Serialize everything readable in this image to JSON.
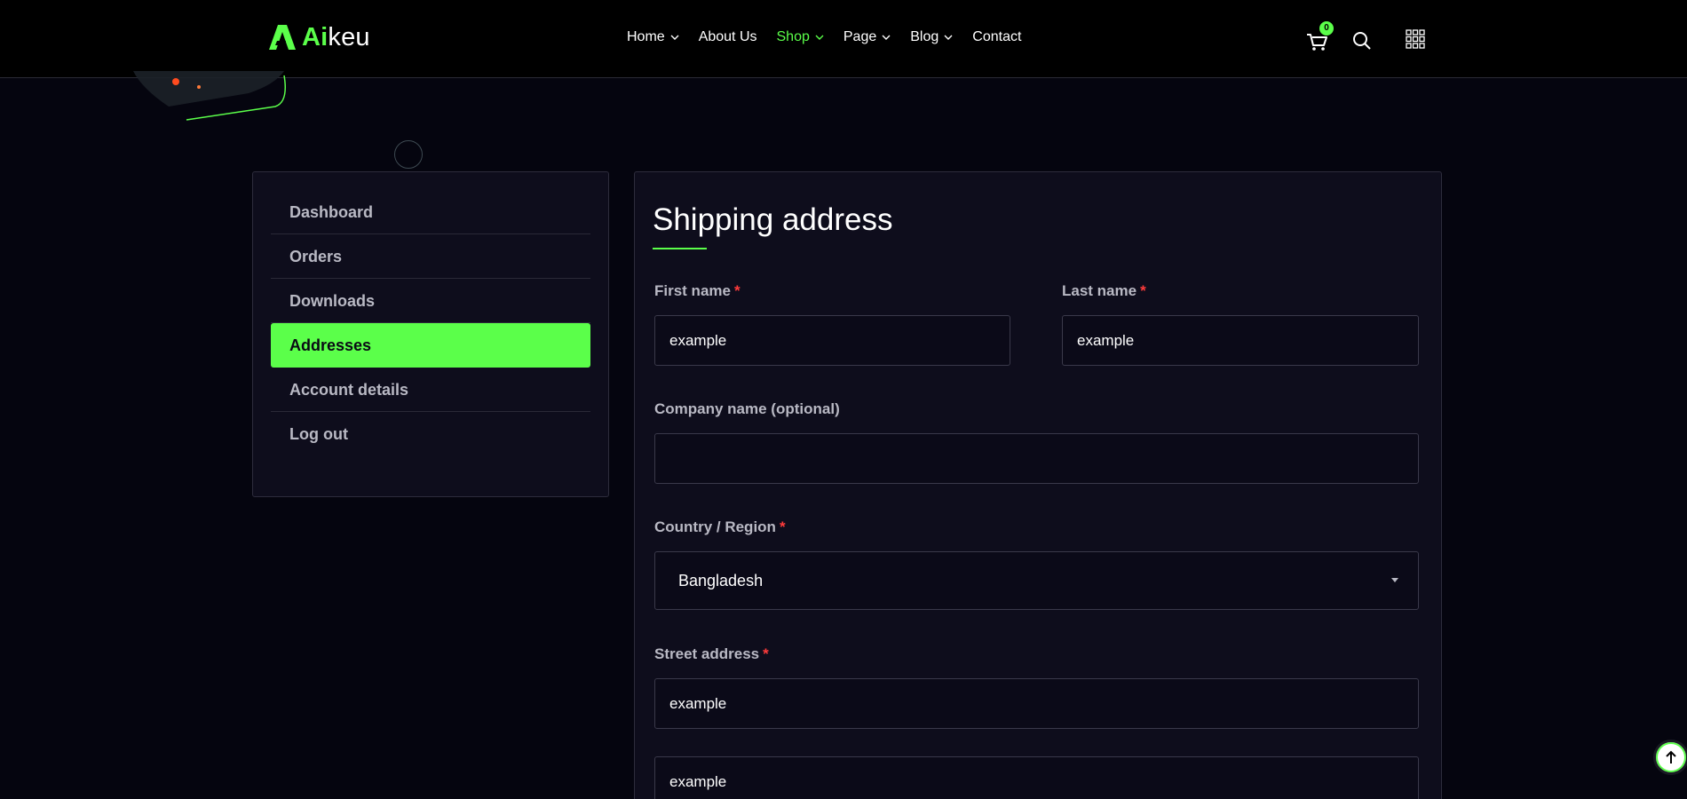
{
  "brand": {
    "name_accent": "Ai",
    "name_rest": "keu",
    "accent_color": "#5bff4a"
  },
  "nav": {
    "items": [
      {
        "label": "Home",
        "has_dropdown": true,
        "active": false
      },
      {
        "label": "About Us",
        "has_dropdown": false,
        "active": false
      },
      {
        "label": "Shop",
        "has_dropdown": true,
        "active": true
      },
      {
        "label": "Page",
        "has_dropdown": true,
        "active": false
      },
      {
        "label": "Blog",
        "has_dropdown": true,
        "active": false
      },
      {
        "label": "Contact",
        "has_dropdown": false,
        "active": false
      }
    ]
  },
  "header_icons": {
    "cart": "cart-icon",
    "cart_count": "0",
    "search": "search-icon",
    "menu": "grid-menu-icon"
  },
  "sidebar": {
    "items": [
      {
        "label": "Dashboard",
        "active": false
      },
      {
        "label": "Orders",
        "active": false
      },
      {
        "label": "Downloads",
        "active": false
      },
      {
        "label": "Addresses",
        "active": true
      },
      {
        "label": "Account details",
        "active": false
      },
      {
        "label": "Log out",
        "active": false
      }
    ]
  },
  "form": {
    "title": "Shipping address",
    "required_mark": "*",
    "first_name": {
      "label": "First name",
      "value": "example"
    },
    "last_name": {
      "label": "Last name",
      "value": "example"
    },
    "company": {
      "label": "Company name (optional)",
      "value": ""
    },
    "country": {
      "label": "Country / Region",
      "value": "Bangladesh"
    },
    "street": {
      "label": "Street address",
      "value": "example",
      "value2": "example"
    }
  },
  "scroll_top_icon": "arrow-up-icon"
}
